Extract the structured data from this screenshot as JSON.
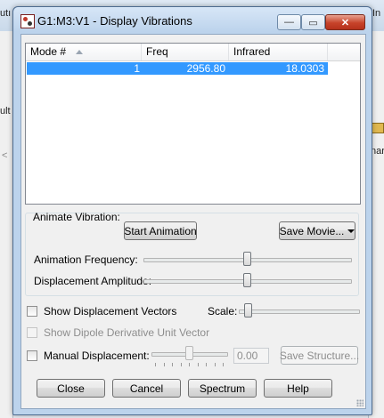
{
  "background": {
    "top_left_fragment": "utı",
    "top_right_fragment": "In",
    "left_mid_fragment": "ult",
    "left_arrow_fragment": "<",
    "right_mid_fragment": "nar"
  },
  "window": {
    "title": "G1:M3:V1 - Display Vibrations",
    "minimize_glyph": "—",
    "maximize_glyph": "▭",
    "close_glyph": "✕"
  },
  "modes_table": {
    "columns": [
      "Mode #",
      "Freq",
      "Infrared"
    ],
    "rows": [
      {
        "mode": "1",
        "freq": "2956.80",
        "infrared": "18.0303",
        "selected": true
      }
    ]
  },
  "animate": {
    "group_label": "Animate Vibration:",
    "start_button": "Start Animation",
    "save_movie_button": "Save Movie...",
    "frequency_label": "Animation Frequency:",
    "amplitude_label": "Displacement Amplitude:",
    "frequency_level": 0.5,
    "amplitude_level": 0.5
  },
  "options": {
    "show_displacement_vectors": {
      "label": "Show Displacement Vectors",
      "checked": false
    },
    "scale_label": "Scale:",
    "scale_level": 0.05,
    "show_dipole": {
      "label": "Show Dipole Derivative Unit Vector",
      "checked": false,
      "disabled": true
    },
    "manual_displacement": {
      "label": "Manual Displacement:",
      "checked": false
    },
    "manual_level": 0.5,
    "manual_value": "0.00",
    "save_structure_button": "Save Structure..."
  },
  "footer": {
    "close_button": "Close",
    "cancel_button": "Cancel",
    "spectrum_button": "Spectrum",
    "help_button": "Help"
  },
  "colors": {
    "selection": "#3399ff",
    "frame": "#bcd3ec"
  }
}
